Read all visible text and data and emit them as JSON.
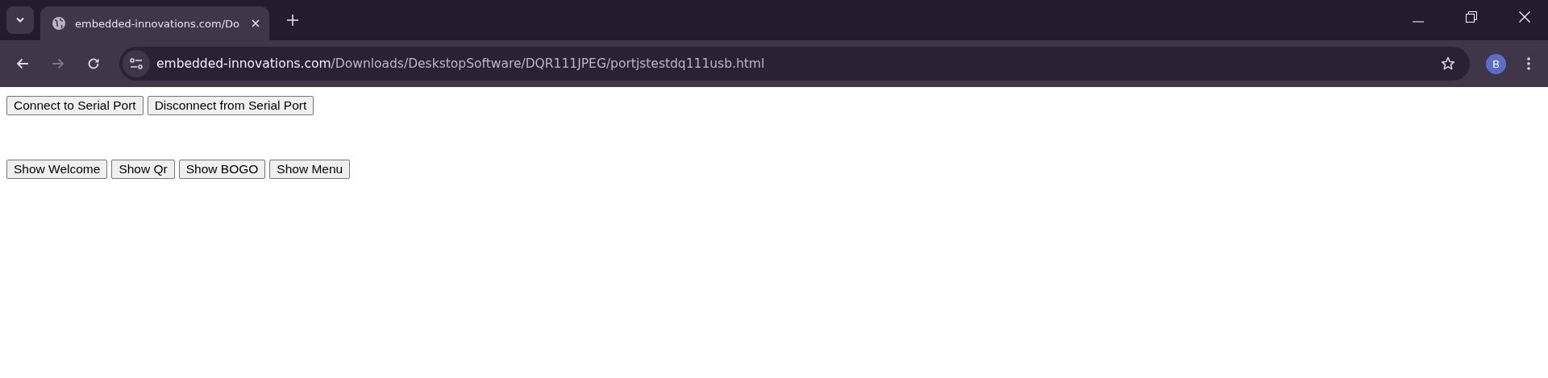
{
  "browser": {
    "tabs": [
      {
        "title": "embedded-innovations.com/Do",
        "selected": true
      }
    ],
    "address": {
      "host": "embedded-innovations.com",
      "path": "/Downloads/DeskstopSoftware/DQR111JPEG/portjstestdq111usb.html"
    },
    "profile": "B"
  },
  "page": {
    "button_rows": [
      [
        "Connect to Serial Port",
        "Disconnect from Serial Port"
      ],
      [
        "Show Welcome",
        "Show Qr",
        "Show BOGO",
        "Show Menu"
      ]
    ]
  }
}
